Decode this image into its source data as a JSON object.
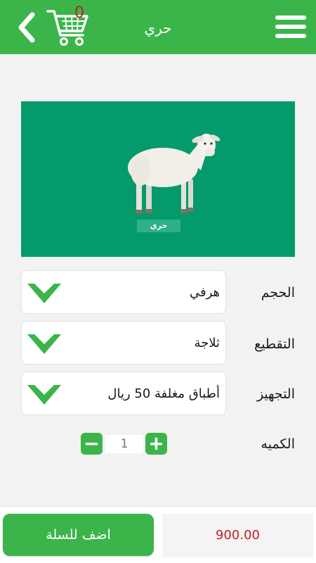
{
  "header": {
    "title": "حري",
    "cart_count": "0",
    "background_color": "#3bb54a",
    "icons": [
      "back-arrow-icon",
      "cart-icon",
      "menu-icon"
    ]
  },
  "product": {
    "image_caption": "حري",
    "image_background": "#049a6b"
  },
  "options": [
    {
      "label": "الحجم",
      "value": "هرفي"
    },
    {
      "label": "التقطيع",
      "value": "ثلاجة"
    },
    {
      "label": "التجهيز",
      "value": "أطباق مغلفة 50 ريال"
    }
  ],
  "quantity": {
    "label": "الكميه",
    "value": "1"
  },
  "footer": {
    "add_to_cart_label": "اضف للسلة",
    "price": "900.00",
    "price_color": "#c0202a"
  }
}
